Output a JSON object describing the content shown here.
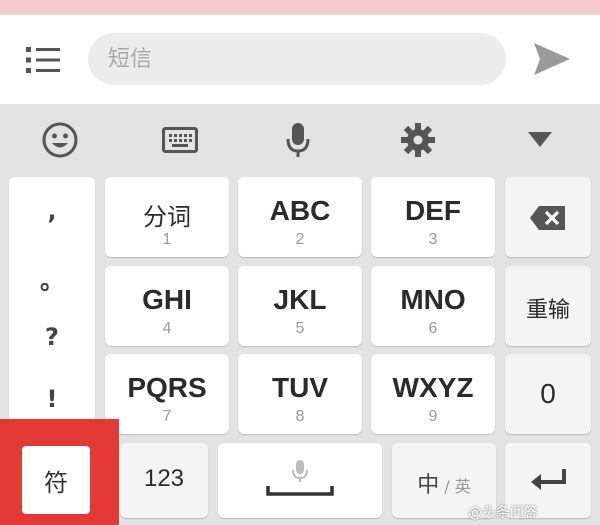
{
  "compose": {
    "placeholder": "短信"
  },
  "toolbar": {
    "icons": [
      "emoji-icon",
      "keyboard-icon",
      "microphone-icon",
      "gear-icon",
      "collapse-triangle-icon"
    ]
  },
  "punctuation": [
    ",",
    "。",
    "?",
    "!"
  ],
  "keys": {
    "fenci": {
      "main": "分词",
      "sub": "1"
    },
    "abc": {
      "main": "ABC",
      "sub": "2"
    },
    "def": {
      "main": "DEF",
      "sub": "3"
    },
    "ghi": {
      "main": "GHI",
      "sub": "4"
    },
    "jkl": {
      "main": "JKL",
      "sub": "5"
    },
    "mno": {
      "main": "MNO",
      "sub": "6"
    },
    "pqrs": {
      "main": "PQRS",
      "sub": "7"
    },
    "tuv": {
      "main": "TUV",
      "sub": "8"
    },
    "wxyz": {
      "main": "WXYZ",
      "sub": "9"
    },
    "retype": "重输",
    "zero": "0",
    "symbol": "符",
    "num123": "123",
    "lang_zh": "中",
    "lang_sep": "/",
    "lang_en": "英"
  },
  "watermark": "@头条问答",
  "colors": {
    "highlight": "#e53935",
    "top_strip": "#f6c9cf",
    "keyboard_bg": "#e3e3e3"
  }
}
